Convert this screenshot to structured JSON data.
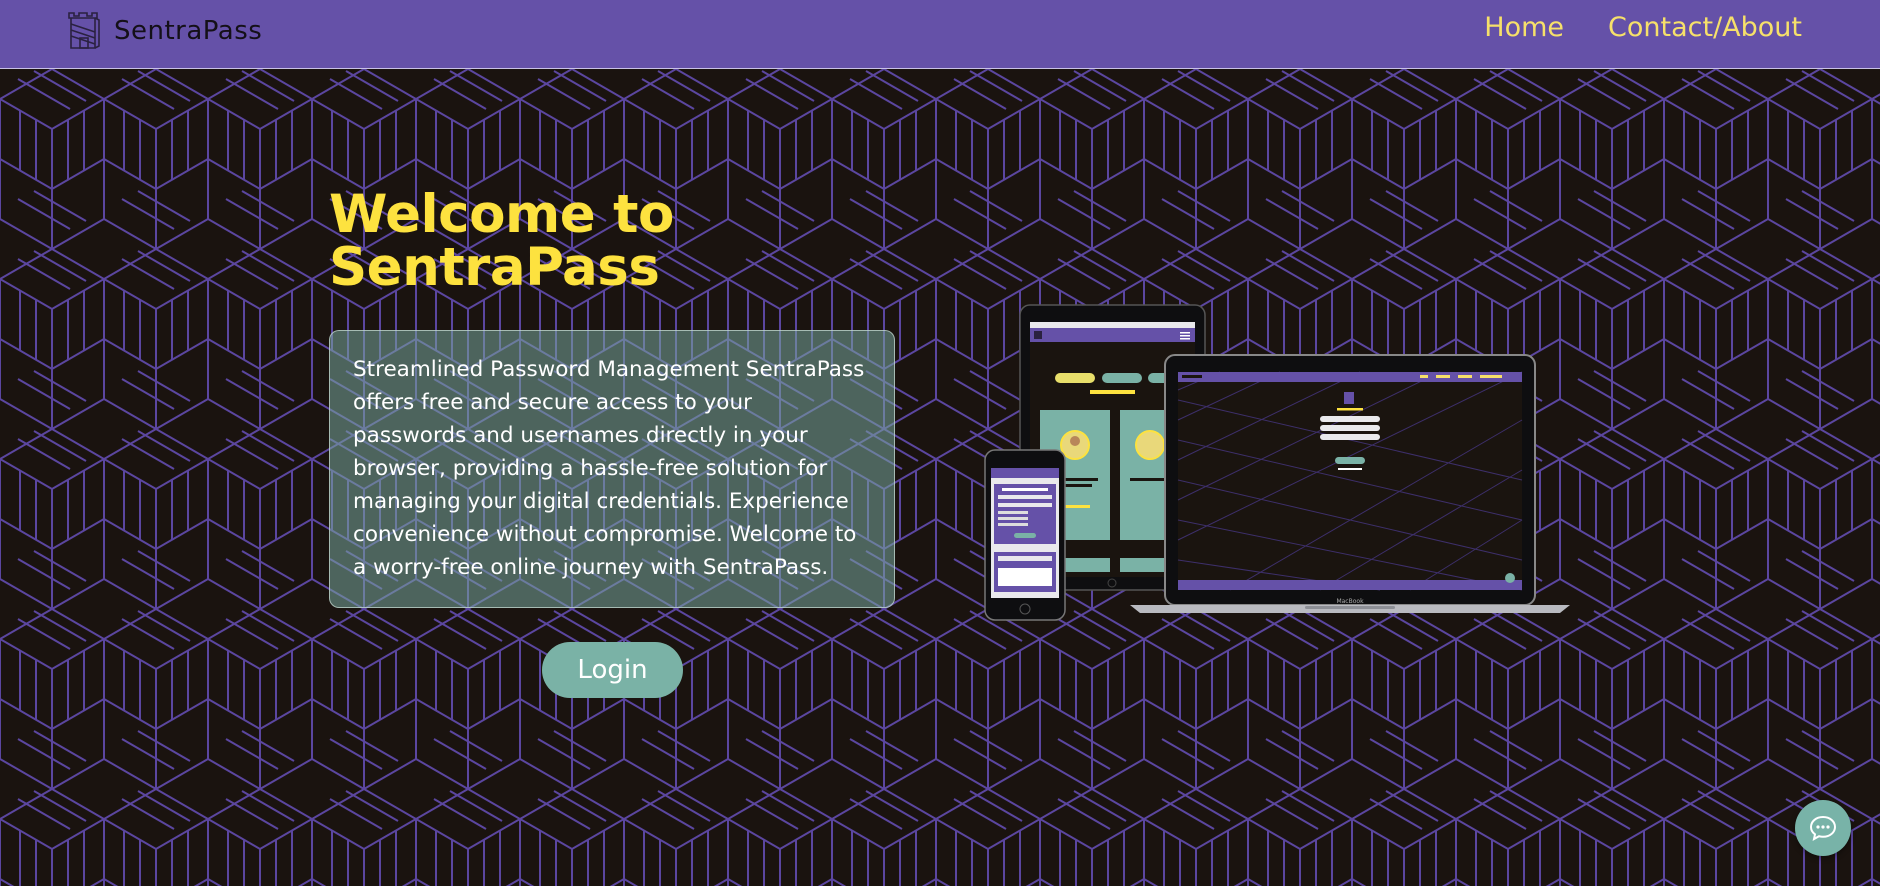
{
  "navbar": {
    "brand_name": "SentraPass",
    "logo_icon": "castle-icon",
    "links": [
      {
        "label": "Home"
      },
      {
        "label": "Contact/About"
      }
    ]
  },
  "hero": {
    "title_line1": "Welcome to",
    "title_line2": "SentraPass",
    "description": "Streamlined Password Management SentraPass offers free and secure access to your passwords and usernames directly in your browser, providing a hassle-free solution for managing your digital credentials. Experience convenience without compromise. Welcome to a worry-free online journey with SentraPass.",
    "login_label": "Login"
  },
  "mockup": {
    "laptop_brand": "MacBook"
  },
  "chat": {
    "icon": "chat-bubble-icon"
  },
  "colors": {
    "navbar_bg": "#6551a8",
    "accent_yellow": "#fde23f",
    "nav_link": "#f6e06a",
    "teal": "#7ab2a6",
    "page_bg": "#1a130f",
    "pattern_line": "#5b46a0"
  }
}
